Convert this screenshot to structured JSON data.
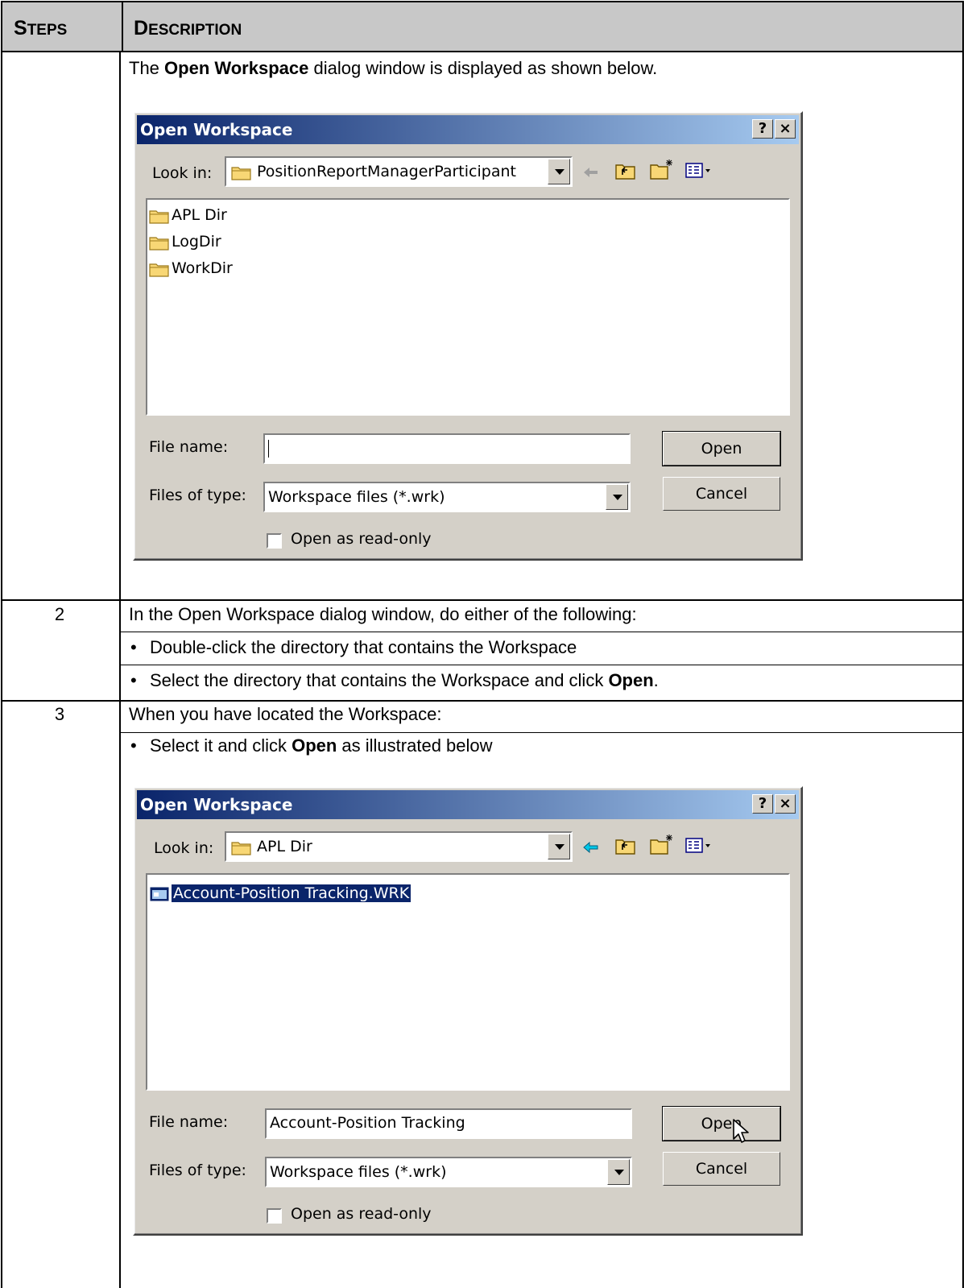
{
  "header": {
    "steps_first": "S",
    "steps_rest": "TEPS",
    "desc_first": "D",
    "desc_rest": "ESCRIPTION"
  },
  "row1": {
    "intro_pre": "The ",
    "intro_bold": "Open Workspace",
    "intro_post": " dialog window is displayed as shown below."
  },
  "dialog1": {
    "title": "Open Workspace",
    "help_btn": "?",
    "close_btn": "×",
    "look_in_label": "Look in:",
    "look_in_value": "PositionReportManagerParticipant",
    "files": [
      "APL Dir",
      "LogDir",
      "WorkDir"
    ],
    "file_name_label": "File name:",
    "file_name_value": "",
    "files_of_type_label": "Files of type:",
    "files_of_type_value": "Workspace files (*.wrk)",
    "open_btn": "Open",
    "cancel_btn": "Cancel",
    "readonly_label": "Open as read-only"
  },
  "row2": {
    "step": "2",
    "text": "In the Open Workspace dialog window, do either of the following:",
    "bullet1": "Double-click the directory that contains the Workspace",
    "bullet2_pre": "Select the directory that contains the Workspace and click ",
    "bullet2_bold": "Open",
    "bullet2_post": "."
  },
  "row3": {
    "step": "3",
    "text": "When you have located the Workspace:",
    "bullet_pre": "Select it and click ",
    "bullet_bold": "Open",
    "bullet_post": " as illustrated below"
  },
  "dialog2": {
    "title": "Open Workspace",
    "help_btn": "?",
    "close_btn": "×",
    "look_in_label": "Look in:",
    "look_in_value": "APL Dir",
    "files": [
      "Account-Position Tracking.WRK"
    ],
    "file_name_label": "File name:",
    "file_name_value": "Account-Position Tracking",
    "files_of_type_label": "Files of type:",
    "files_of_type_value": "Workspace files (*.wrk)",
    "open_btn": "Open",
    "cancel_btn": "Cancel",
    "readonly_label": "Open as read-only"
  },
  "colors": {
    "header_bg": "#c8c8c8",
    "titlebar_start": "#0a246a",
    "titlebar_end": "#a6caf0",
    "dialog_face": "#d4d0c8"
  }
}
